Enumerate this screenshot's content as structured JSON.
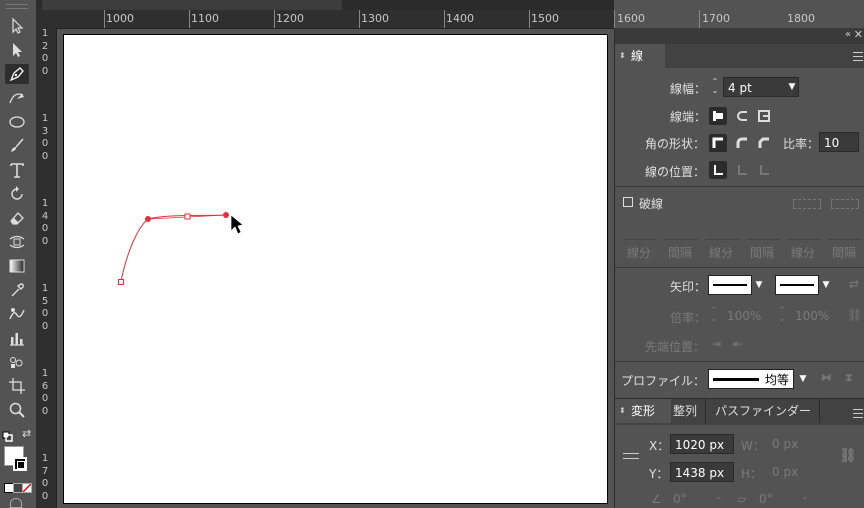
{
  "ruler": {
    "h_labels": [
      "1000",
      "1100",
      "1200",
      "1300",
      "1400",
      "1500",
      "1600",
      "1700",
      "1800"
    ],
    "v_labels": [
      "1200",
      "1300",
      "1400",
      "1500",
      "1600",
      "1700"
    ]
  },
  "stroke_panel": {
    "tab": "線",
    "weight_label": "線幅：",
    "weight_value": "4 pt",
    "cap_label": "線端：",
    "corner_label": "角の形状：",
    "ratio_label": "比率：",
    "ratio_value": "10",
    "align_label": "線の位置：",
    "dashed_label": "破線",
    "dash_headers": [
      "線分",
      "間隔",
      "線分",
      "間隔",
      "線分",
      "間隔"
    ],
    "arrow_label": "矢印：",
    "scale_label": "倍率：",
    "scale_value_1": "100%",
    "scale_value_2": "100%",
    "tip_label": "先端位置：",
    "profile_label": "プロファイル：",
    "profile_value": "均等"
  },
  "transform_panel": {
    "tabs": [
      "変形",
      "整列",
      "パスファインダー"
    ],
    "x_label": "X：",
    "x_value": "1020 px",
    "y_label": "Y：",
    "y_value": "1438 px",
    "w_label": "W：",
    "w_value": "0 px",
    "h_label": "H：",
    "h_value": "0 px",
    "angle_value": "0°",
    "shear_value": "0°"
  },
  "colors": {
    "path": "#e0303a",
    "panel_bg": "#535353",
    "ruler_bg": "#2f2f2f"
  }
}
